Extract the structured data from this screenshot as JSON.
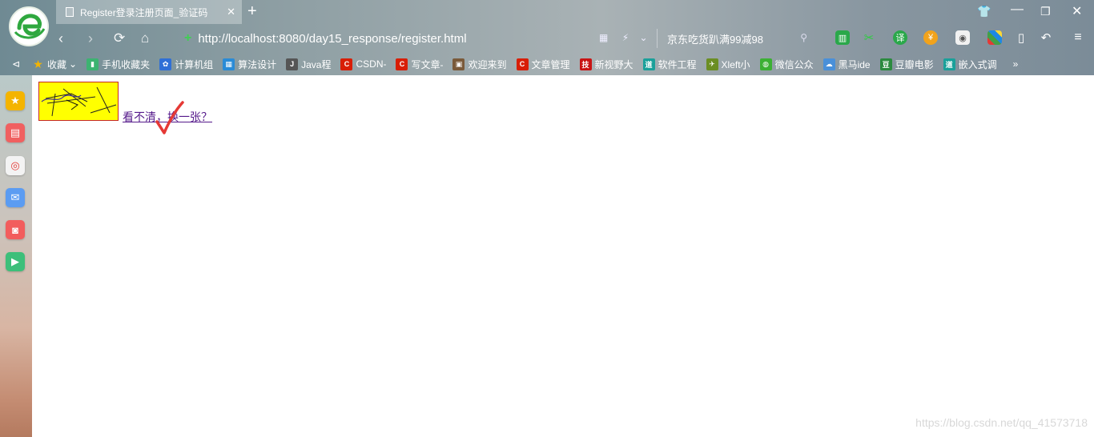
{
  "tab": {
    "title": "Register登录注册页面_验证码"
  },
  "address_bar": {
    "url": "http://localhost:8080/day15_response/register.html"
  },
  "search": {
    "text": "京东吃货趴满99减98"
  },
  "bookmarks": [
    {
      "label": "收藏",
      "icon": "star-icon",
      "color": "#f4b400"
    },
    {
      "label": "手机收藏夹",
      "icon": "phone-icon",
      "color": "#3cb371"
    },
    {
      "label": "计算机组",
      "icon": "paw-icon",
      "color": "#2f6fd6"
    },
    {
      "label": "算法设计",
      "icon": "book-icon",
      "color": "#2a8bd6"
    },
    {
      "label": "Java程",
      "icon": "java-icon",
      "color": "#555555"
    },
    {
      "label": "CSDN-",
      "icon": "csdn-icon",
      "color": "#d81e06"
    },
    {
      "label": "写文章-",
      "icon": "csdn-icon",
      "color": "#d81e06"
    },
    {
      "label": "欢迎来到",
      "icon": "image-icon",
      "color": "#7a5a3a"
    },
    {
      "label": "文章管理",
      "icon": "csdn-icon",
      "color": "#d81e06"
    },
    {
      "label": "新视野大",
      "icon": "tech-icon",
      "color": "#c81414"
    },
    {
      "label": "软件工程",
      "icon": "dao-icon",
      "color": "#1aa09a"
    },
    {
      "label": "Xleft小",
      "icon": "xleft-icon",
      "color": "#6b8e23"
    },
    {
      "label": "微信公众",
      "icon": "wechat-icon",
      "color": "#3cb034"
    },
    {
      "label": "黑马ide",
      "icon": "cloud-icon",
      "color": "#4a90d9"
    },
    {
      "label": "豆瓣电影",
      "icon": "douban-icon",
      "color": "#2b8a3e"
    },
    {
      "label": "嵌入式调",
      "icon": "dao-icon",
      "color": "#1aa09a"
    }
  ],
  "page": {
    "refresh_link": "看不清，换一张？"
  },
  "watermark": "https://blog.csdn.net/qq_41573718",
  "colors": {
    "captcha_bg": "#ffff00",
    "captcha_border": "#c62828",
    "link": "#551a8b",
    "check": "#e53935"
  }
}
